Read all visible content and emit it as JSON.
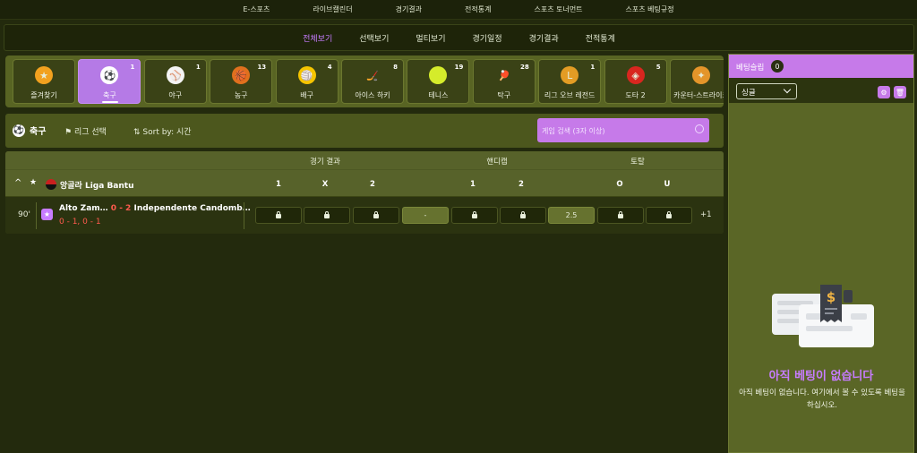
{
  "topnav": [
    "E-스포츠",
    "라이브캘린더",
    "경기결과",
    "전적통계",
    "스포츠 토너먼트",
    "스포츠 베팅규정"
  ],
  "subnav": {
    "items": [
      "전체보기",
      "선택보기",
      "멀티보기",
      "경기일정",
      "경기결과",
      "전적통계"
    ],
    "active_index": 0
  },
  "sports": [
    {
      "label": "즐겨찾기",
      "count": "",
      "icon": "star-icon",
      "color": "#f2a11f",
      "glyph": "★"
    },
    {
      "label": "축구",
      "count": "1",
      "icon": "soccer-ball-icon",
      "color": "#ffffff",
      "glyph": "⚽"
    },
    {
      "label": "야구",
      "count": "1",
      "icon": "baseball-icon",
      "color": "#f4f4f4",
      "glyph": "⚾"
    },
    {
      "label": "농구",
      "count": "13",
      "icon": "basketball-icon",
      "color": "#e0701e",
      "glyph": "🏀"
    },
    {
      "label": "배구",
      "count": "4",
      "icon": "volleyball-icon",
      "color": "#f5c400",
      "glyph": "🏐"
    },
    {
      "label": "아이스 하키",
      "count": "8",
      "icon": "hockey-stick-icon",
      "color": "transparent",
      "glyph": "🏒"
    },
    {
      "label": "테니스",
      "count": "19",
      "icon": "tennis-ball-icon",
      "color": "#d5ec2b",
      "glyph": ""
    },
    {
      "label": "탁구",
      "count": "28",
      "icon": "table-tennis-icon",
      "color": "transparent",
      "glyph": "🏓"
    },
    {
      "label": "리그 오브 레전드",
      "count": "1",
      "icon": "league-of-legends-icon",
      "color": "#e39c24",
      "glyph": "L"
    },
    {
      "label": "도타 2",
      "count": "5",
      "icon": "dota2-icon",
      "color": "#d8261f",
      "glyph": "◈"
    },
    {
      "label": "카운터-스트라이크",
      "count": "",
      "icon": "counter-strike-icon",
      "color": "#e4952a",
      "glyph": "✦"
    }
  ],
  "active_sport": 1,
  "filter": {
    "sport": "축구",
    "league_btn": "리그 선택",
    "sort": "Sort by: 시간",
    "search_placeholder": "게임 검색 (3자 이상)"
  },
  "market": {
    "groups": [
      "경기 결과",
      "핸디캡",
      "토탈"
    ],
    "league": "앙골라 Liga Bantu",
    "cols": [
      "1",
      "X",
      "2",
      "1",
      "2",
      "O",
      "U"
    ],
    "match": {
      "minute": "90'",
      "home": "Alto Zam…",
      "score": "0 - 2",
      "away": "Independente Candomb…",
      "halves": "0 - 1, 0 - 1",
      "odds": [
        "lock",
        "lock",
        "lock",
        "-",
        "lock",
        "lock",
        "2.5",
        "lock",
        "lock"
      ],
      "more": "+1"
    }
  },
  "slip": {
    "title": "베팅슬립",
    "count": "0",
    "mode": "싱글",
    "empty_title": "아직 베팅이 없습니다",
    "empty_desc": "아직 베팅이 없습니다. 여기에서 볼 수 있도록 베팅을 하십시오."
  },
  "colors": {
    "accent": "#c67ae9",
    "background": "#232a0d",
    "live_score": "#ff5a4e"
  }
}
